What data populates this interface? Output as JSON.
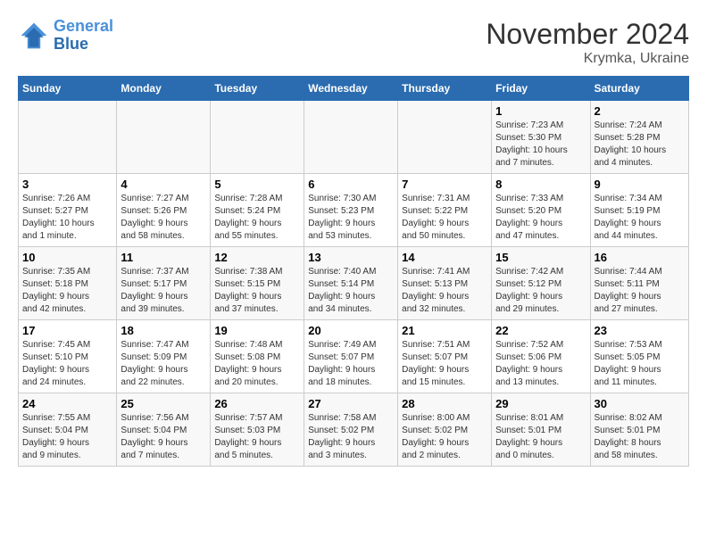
{
  "header": {
    "logo_line1": "General",
    "logo_line2": "Blue",
    "month_title": "November 2024",
    "subtitle": "Krymka, Ukraine"
  },
  "weekdays": [
    "Sunday",
    "Monday",
    "Tuesday",
    "Wednesday",
    "Thursday",
    "Friday",
    "Saturday"
  ],
  "weeks": [
    [
      {
        "day": "",
        "info": ""
      },
      {
        "day": "",
        "info": ""
      },
      {
        "day": "",
        "info": ""
      },
      {
        "day": "",
        "info": ""
      },
      {
        "day": "",
        "info": ""
      },
      {
        "day": "1",
        "info": "Sunrise: 7:23 AM\nSunset: 5:30 PM\nDaylight: 10 hours\nand 7 minutes."
      },
      {
        "day": "2",
        "info": "Sunrise: 7:24 AM\nSunset: 5:28 PM\nDaylight: 10 hours\nand 4 minutes."
      }
    ],
    [
      {
        "day": "3",
        "info": "Sunrise: 7:26 AM\nSunset: 5:27 PM\nDaylight: 10 hours\nand 1 minute."
      },
      {
        "day": "4",
        "info": "Sunrise: 7:27 AM\nSunset: 5:26 PM\nDaylight: 9 hours\nand 58 minutes."
      },
      {
        "day": "5",
        "info": "Sunrise: 7:28 AM\nSunset: 5:24 PM\nDaylight: 9 hours\nand 55 minutes."
      },
      {
        "day": "6",
        "info": "Sunrise: 7:30 AM\nSunset: 5:23 PM\nDaylight: 9 hours\nand 53 minutes."
      },
      {
        "day": "7",
        "info": "Sunrise: 7:31 AM\nSunset: 5:22 PM\nDaylight: 9 hours\nand 50 minutes."
      },
      {
        "day": "8",
        "info": "Sunrise: 7:33 AM\nSunset: 5:20 PM\nDaylight: 9 hours\nand 47 minutes."
      },
      {
        "day": "9",
        "info": "Sunrise: 7:34 AM\nSunset: 5:19 PM\nDaylight: 9 hours\nand 44 minutes."
      }
    ],
    [
      {
        "day": "10",
        "info": "Sunrise: 7:35 AM\nSunset: 5:18 PM\nDaylight: 9 hours\nand 42 minutes."
      },
      {
        "day": "11",
        "info": "Sunrise: 7:37 AM\nSunset: 5:17 PM\nDaylight: 9 hours\nand 39 minutes."
      },
      {
        "day": "12",
        "info": "Sunrise: 7:38 AM\nSunset: 5:15 PM\nDaylight: 9 hours\nand 37 minutes."
      },
      {
        "day": "13",
        "info": "Sunrise: 7:40 AM\nSunset: 5:14 PM\nDaylight: 9 hours\nand 34 minutes."
      },
      {
        "day": "14",
        "info": "Sunrise: 7:41 AM\nSunset: 5:13 PM\nDaylight: 9 hours\nand 32 minutes."
      },
      {
        "day": "15",
        "info": "Sunrise: 7:42 AM\nSunset: 5:12 PM\nDaylight: 9 hours\nand 29 minutes."
      },
      {
        "day": "16",
        "info": "Sunrise: 7:44 AM\nSunset: 5:11 PM\nDaylight: 9 hours\nand 27 minutes."
      }
    ],
    [
      {
        "day": "17",
        "info": "Sunrise: 7:45 AM\nSunset: 5:10 PM\nDaylight: 9 hours\nand 24 minutes."
      },
      {
        "day": "18",
        "info": "Sunrise: 7:47 AM\nSunset: 5:09 PM\nDaylight: 9 hours\nand 22 minutes."
      },
      {
        "day": "19",
        "info": "Sunrise: 7:48 AM\nSunset: 5:08 PM\nDaylight: 9 hours\nand 20 minutes."
      },
      {
        "day": "20",
        "info": "Sunrise: 7:49 AM\nSunset: 5:07 PM\nDaylight: 9 hours\nand 18 minutes."
      },
      {
        "day": "21",
        "info": "Sunrise: 7:51 AM\nSunset: 5:07 PM\nDaylight: 9 hours\nand 15 minutes."
      },
      {
        "day": "22",
        "info": "Sunrise: 7:52 AM\nSunset: 5:06 PM\nDaylight: 9 hours\nand 13 minutes."
      },
      {
        "day": "23",
        "info": "Sunrise: 7:53 AM\nSunset: 5:05 PM\nDaylight: 9 hours\nand 11 minutes."
      }
    ],
    [
      {
        "day": "24",
        "info": "Sunrise: 7:55 AM\nSunset: 5:04 PM\nDaylight: 9 hours\nand 9 minutes."
      },
      {
        "day": "25",
        "info": "Sunrise: 7:56 AM\nSunset: 5:04 PM\nDaylight: 9 hours\nand 7 minutes."
      },
      {
        "day": "26",
        "info": "Sunrise: 7:57 AM\nSunset: 5:03 PM\nDaylight: 9 hours\nand 5 minutes."
      },
      {
        "day": "27",
        "info": "Sunrise: 7:58 AM\nSunset: 5:02 PM\nDaylight: 9 hours\nand 3 minutes."
      },
      {
        "day": "28",
        "info": "Sunrise: 8:00 AM\nSunset: 5:02 PM\nDaylight: 9 hours\nand 2 minutes."
      },
      {
        "day": "29",
        "info": "Sunrise: 8:01 AM\nSunset: 5:01 PM\nDaylight: 9 hours\nand 0 minutes."
      },
      {
        "day": "30",
        "info": "Sunrise: 8:02 AM\nSunset: 5:01 PM\nDaylight: 8 hours\nand 58 minutes."
      }
    ]
  ]
}
